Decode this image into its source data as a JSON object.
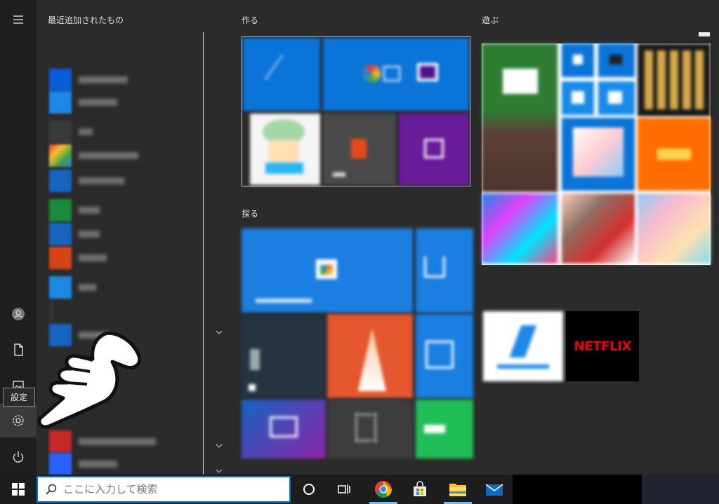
{
  "start_menu": {
    "applist_header": "最近追加されたもの",
    "rail": {
      "tooltip": "設定",
      "icons": [
        "hamburger-icon",
        "user-icon",
        "document-icon",
        "pictures-icon",
        "gear-icon",
        "power-icon"
      ]
    },
    "groups": {
      "create": "作る",
      "explore": "探る",
      "play": "遊ぶ"
    },
    "tiles": {
      "netflix": "NETFLIX"
    }
  },
  "taskbar": {
    "search_placeholder": "ここに入力して検索",
    "icons": [
      "windows-icon",
      "search-icon",
      "cortana-icon",
      "task-view-icon",
      "chrome-icon",
      "store-icon",
      "file-explorer-icon",
      "mail-icon"
    ]
  },
  "colors": {
    "accent": "#0078d7",
    "background": "#2b2b2b",
    "rail": "#1f1f1f",
    "taskbar": "#1d1d1d"
  }
}
